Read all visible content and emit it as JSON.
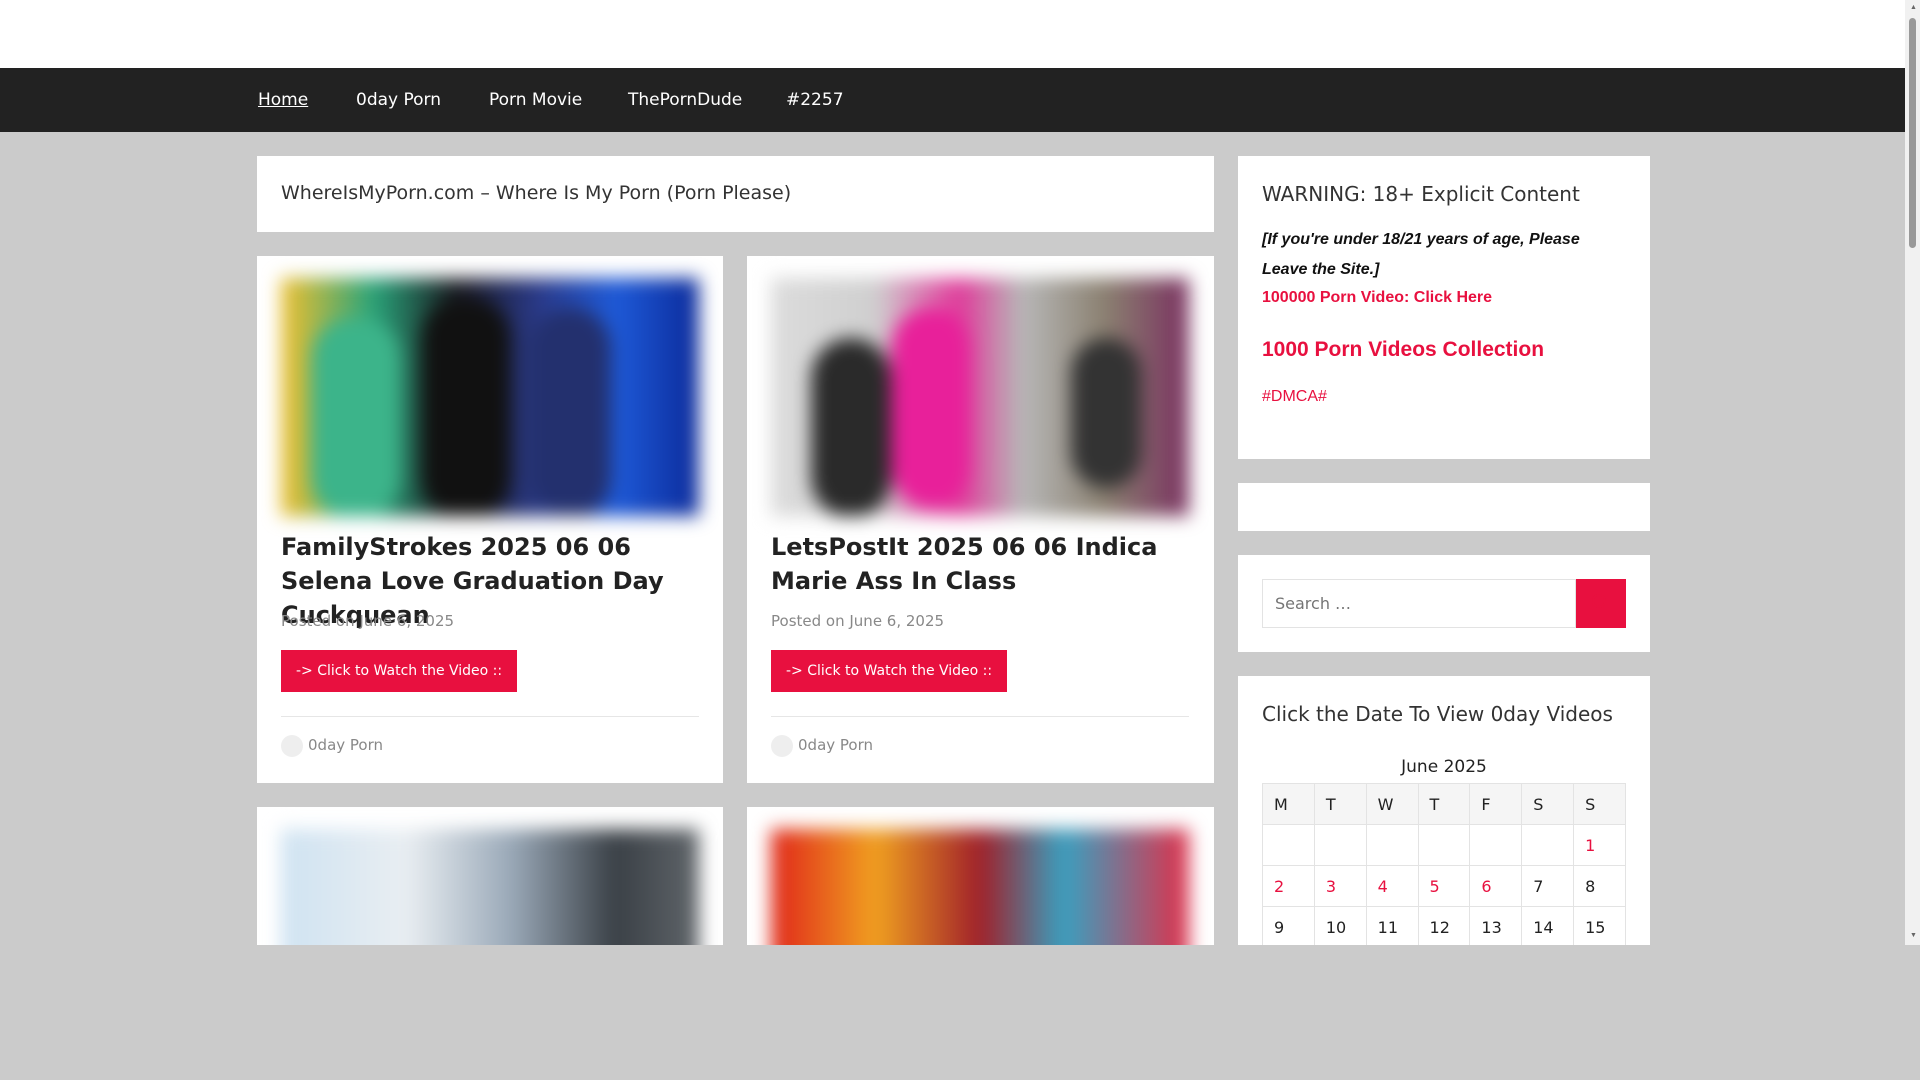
{
  "nav": {
    "items": [
      {
        "label": "Home",
        "active": true
      },
      {
        "label": "0day Porn"
      },
      {
        "label": "Porn Movie"
      },
      {
        "label": "ThePornDude"
      },
      {
        "label": "#2257"
      }
    ]
  },
  "site": {
    "title": "WhereIsMyPorn.com – Where Is My Porn (Porn Please)"
  },
  "posts": [
    {
      "title": "FamilyStrokes 2025 06 06 Selena Love Graduation Day Cuckquean",
      "posted_prefix": "Posted on",
      "date": "June 6, 2025",
      "button": "-> Click to Watch the Video ::",
      "category": "0day Porn"
    },
    {
      "title": "LetsPostIt 2025 06 06 Indica Marie Ass In Class",
      "posted_prefix": "Posted on",
      "date": "June 6, 2025",
      "button": "-> Click to Watch the Video ::",
      "category": "0day Porn"
    }
  ],
  "sidebar": {
    "warning": {
      "title": "WARNING: 18+ Explicit Content",
      "text": "[If you're under 18/21 years of age, Please Leave the Site.]",
      "link1": "100000 Porn Video: Click Here",
      "link2": "1000 Porn Videos Collection",
      "link3": "#DMCA#"
    },
    "search": {
      "placeholder": "Search …"
    },
    "calendar": {
      "title": "Click the Date To View 0day Videos",
      "caption": "June 2025",
      "weekdays": [
        "M",
        "T",
        "W",
        "T",
        "F",
        "S",
        "S"
      ],
      "rows": [
        [
          "",
          "",
          "",
          "",
          "",
          "",
          "1"
        ],
        [
          "2",
          "3",
          "4",
          "5",
          "6",
          "7",
          "8"
        ],
        [
          "9",
          "10",
          "11",
          "12",
          "13",
          "14",
          "15"
        ]
      ]
    }
  },
  "colors": {
    "accent": "#e8103f",
    "nav_bg": "#222222",
    "page_bg": "#cbcbcb"
  }
}
